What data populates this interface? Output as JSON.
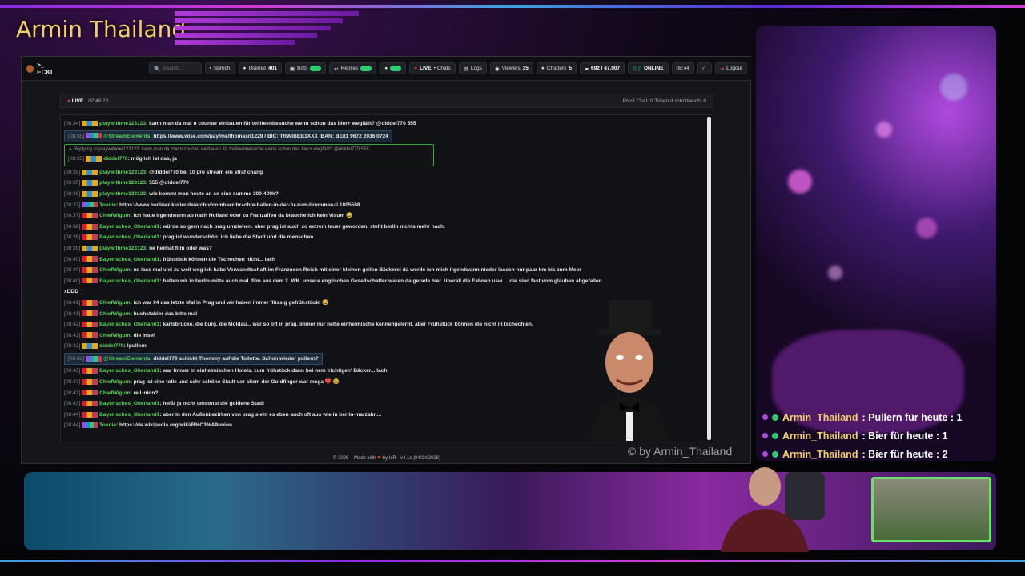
{
  "overlay": {
    "title": "Armin Thailand",
    "watermark": "© by Armin_Thailand"
  },
  "topbar": {
    "brand": ">_ ECKI",
    "search_placeholder": "Search...",
    "spruch": "Spruch",
    "userlist_label": "Userlist",
    "userlist_count": "401",
    "bots": "Bots",
    "replies": "Replies",
    "live": "LIVE",
    "chats": "• Chats",
    "logs": "Logs",
    "viewers_label": "Viewers",
    "viewers_count": "35",
    "chatters_label": "Chatters",
    "chatters_count": "5",
    "messages": "692 / 47.907",
    "online": "ONLINE",
    "time": "08:44",
    "logout": "Logout"
  },
  "livebar": {
    "live": "LIVE",
    "uptime": "02:46:23",
    "right": "Prost Chat: 0  Timeout schnitlauch: 0"
  },
  "messages": [
    {
      "time": "[08:34]",
      "badge": "b1",
      "user": "playwithme123123",
      "text": "kann man da mal n counter einbauen für toiliteenbesuche wenn schon das bier+ wegfällt? @diddel770 555"
    },
    {
      "time": "[08:35]",
      "badge": "b3",
      "user": "@StreamElements",
      "text": "https://www.wise.com/pay/me/thomasn1229 / BIC: TRWIBEB1XXX IBAN: BE81 9672 2036 0724",
      "hl": true
    },
    {
      "time": "[08:35]",
      "badge": "b1",
      "user": "diddel770",
      "text": "möglich ist das, ja",
      "reply": "↳ Replying to playwithme123123: kann man da mal n counter einbauen für toiliteenbesuche wenn schon das bier+ wegfällt? @diddel770 555"
    },
    {
      "time": "[08:35]",
      "badge": "b1",
      "user": "playwithme123123",
      "text": "@diddel770 bei 10 pro stream ein straf chang"
    },
    {
      "time": "[08:35]",
      "badge": "b1",
      "user": "playwithme123123",
      "text": "555 @diddel770"
    },
    {
      "time": "[08:36]",
      "badge": "b1",
      "user": "playwithme123123",
      "text": "wie kommt man heute an so eine summe 300-400k?"
    },
    {
      "time": "[08:37]",
      "badge": "b3",
      "user": "Tosnie",
      "text": "https://www.berliner-kurier.de/archiv/combaer-brachte-hallen-in-der-fu-zum-brummen-li.1805588"
    },
    {
      "time": "[08:37]",
      "badge": "b2",
      "user": "ChiefWigum",
      "text": "ich haue irgendwann ab nach Holland oder zu Franzaffen da brauche ich kein Visum 😂"
    },
    {
      "time": "[08:38]",
      "badge": "b2",
      "user": "Bayerisches_Oberland1",
      "text": "würde so gern nach prag umziehen. aber prag ist auch so extrem teuer geworden. steht berlin nichts mehr nach."
    },
    {
      "time": "[08:39]",
      "badge": "b2",
      "user": "Bayerisches_Oberland1",
      "text": "prag ist wunderschön. ich liebe die Stadt und die menschen"
    },
    {
      "time": "[08:39]",
      "badge": "b1",
      "user": "playwithme123123",
      "text": "ne heimat film oder was?"
    },
    {
      "time": "[08:40]",
      "badge": "b2",
      "user": "Bayerisches_Oberland1",
      "text": "frühstück können die Tschechen nicht... lach"
    },
    {
      "time": "[08:40]",
      "badge": "b2",
      "user": "ChiefWigum",
      "text": "ne lass mal viel zu weit weg ich habe Verwandtschaft im Franzosen Reich mit einer kleinen geilen Bäckerei da werde ich mich irgendwann nieder lassen nur paar km bis zum Meer"
    },
    {
      "time": "[08:40]",
      "badge": "b2",
      "user": "Bayerisches_Oberland1",
      "text": "hatten wir in berlin-mitte auch mal. film aus dem 2. WK. unsere englischen Gesellschafter waren da gerade hier. überall die Fahnen usw.... die sind fast vom glauben abgefallen"
    },
    {
      "time": "",
      "badge": "",
      "user": "",
      "text": "xDDD"
    },
    {
      "time": "[08:41]",
      "badge": "b2",
      "user": "ChiefWigum",
      "text": "ich war 94 das letzte Mal in Prag und wir haben immer flüssig gefrühstückt 😂"
    },
    {
      "time": "[08:41]",
      "badge": "b2",
      "user": "ChiefWigum",
      "text": "buchstabier das bitte mal"
    },
    {
      "time": "[08:42]",
      "badge": "b2",
      "user": "Bayerisches_Oberland1",
      "text": "karlsbrücke, die burg, die Moldau... war so oft in prag. immer nur nette einheimische kennengelernt. aber Frühstück können die nicht in tschechien."
    },
    {
      "time": "[08:42]",
      "badge": "b2",
      "user": "ChiefWigum",
      "text": "die Insel"
    },
    {
      "time": "[08:42]",
      "badge": "b1",
      "user": "diddel770",
      "text": "!pullern"
    },
    {
      "time": "[08:42]",
      "badge": "b3",
      "user": "@StreamElements",
      "text": "diddel770 schickt Thommy auf die Toilette. Schon wieder pullern?",
      "hl": true
    },
    {
      "time": "[08:43]",
      "badge": "b2",
      "user": "Bayerisches_Oberland1",
      "text": "war Immer in einheimischen Hotels. zum frühstück dann bei nem 'richtigen' Bäcker... lach"
    },
    {
      "time": "[08:43]",
      "badge": "b2",
      "user": "ChiefWigum",
      "text": "prag ist eine tolle und sehr schöne Stadt vor allem der Goldfinger war mega ❤️ 😂"
    },
    {
      "time": "[08:43]",
      "badge": "b2",
      "user": "ChiefWigum",
      "text": "re Union?"
    },
    {
      "time": "[08:43]",
      "badge": "b2",
      "user": "Bayerisches_Oberland1",
      "text": "heißt ja nicht umsonst die goldene Stadt"
    },
    {
      "time": "[08:44]",
      "badge": "b2",
      "user": "Bayerisches_Oberland1",
      "text": "aber in den Außenbezirken von prag sieht es eben auch oft aus wie in berlin-marzahn..."
    },
    {
      "time": "[08:44]",
      "badge": "b3",
      "user": "Tosnie",
      "text": "https://de.wikipedia.org/wiki/R%C3%A9union"
    }
  ],
  "footer": {
    "pre": "© 2026 – Made with",
    "heart": "❤",
    "post": "by IcR · v4.1c (04/24/2026)"
  },
  "counters": [
    {
      "name": "Armin_Thailand",
      "text": ": Pullern für heute : 1"
    },
    {
      "name": "Armin_Thailand",
      "text": ": Bier für heute : 1"
    },
    {
      "name": "Armin_Thailand",
      "text": ": Bier für heute : 2"
    }
  ]
}
